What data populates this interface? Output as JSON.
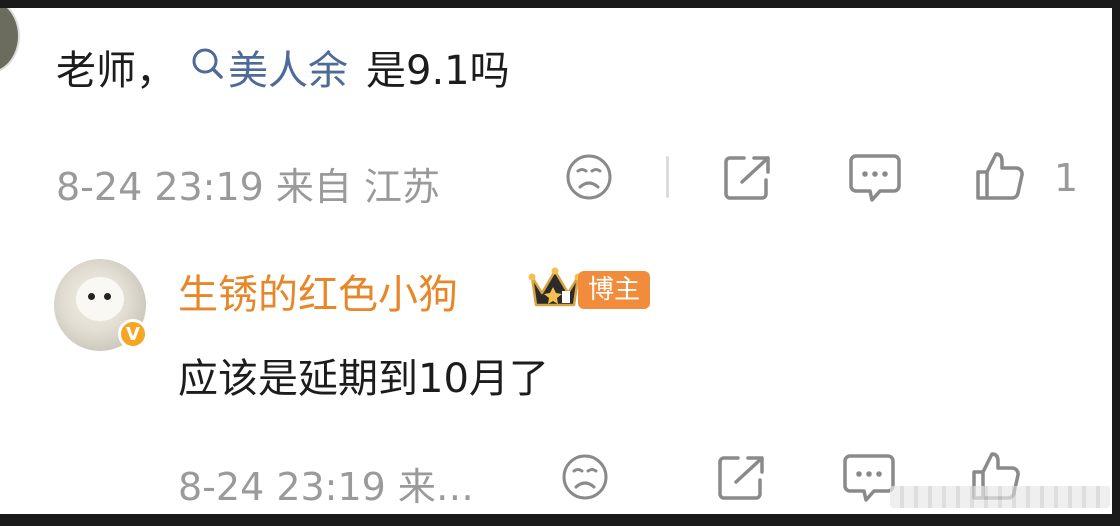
{
  "comment": {
    "prefix": "老师，",
    "topic": "美人余",
    "suffix": "是9.1吗",
    "timestamp": "8-24 23:19 来自 江苏",
    "like_count": "1"
  },
  "reply": {
    "username": "生锈的红色小狗",
    "badge_label": "博主",
    "verified_mark": "V",
    "text": "应该是延期到10月了",
    "timestamp": "8-24 23:19 来…"
  },
  "colors": {
    "text": "#1c1c1c",
    "meta": "#9a9a9a",
    "topic": "#4e6a98",
    "username": "#e8872a",
    "badge": "#f08c3c"
  },
  "icons": [
    "search-icon",
    "dislike-face-icon",
    "share-icon",
    "comment-icon",
    "thumbs-up-icon",
    "crown-icon",
    "verified-badge-icon"
  ]
}
